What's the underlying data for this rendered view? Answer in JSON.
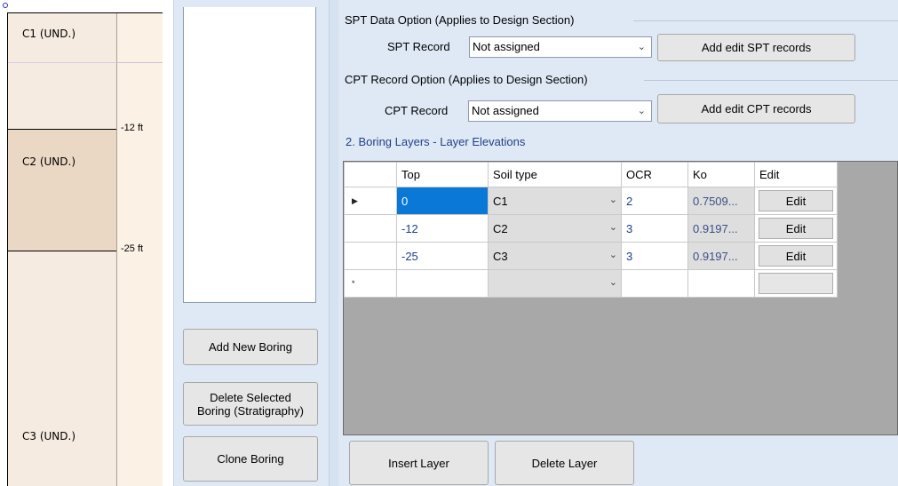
{
  "stratigraphy": {
    "layers": [
      {
        "label": "C1 (UND.)",
        "color": "#f5ebe0"
      },
      {
        "label": "C2 (UND.)",
        "color": "#ead8c4"
      },
      {
        "label": "C3 (UND.)",
        "color": "#f5ebe0"
      }
    ],
    "elevations": [
      "-12 ft",
      "-25 ft"
    ]
  },
  "boring_panel": {
    "add_new_boring": "Add New Boring",
    "delete_selected_boring_line1": "Delete Selected",
    "delete_selected_boring_line2": "Boring (Stratigraphy)",
    "clone_boring": "Clone Boring"
  },
  "spt": {
    "group_title": "SPT Data Option (Applies to Design Section)",
    "label": "SPT Record",
    "value": "Not assigned",
    "button": "Add edit SPT records"
  },
  "cpt": {
    "group_title": "CPT Record Option (Applies to Design Section)",
    "label": "CPT Record",
    "value": "Not assigned",
    "button": "Add edit CPT records"
  },
  "layers_section": {
    "title": "2. Boring Layers - Layer Elevations",
    "columns": [
      "Top",
      "Soil type",
      "OCR",
      "Ko",
      "Edit"
    ],
    "rows": [
      {
        "indicator": "▶",
        "top": "0",
        "soil": "C1",
        "ocr": "2",
        "ko": "0.7509...",
        "edit": "Edit"
      },
      {
        "indicator": "",
        "top": "-12",
        "soil": "C2",
        "ocr": "3",
        "ko": "0.9197...",
        "edit": "Edit"
      },
      {
        "indicator": "",
        "top": "-25",
        "soil": "C3",
        "ocr": "3",
        "ko": "0.9197...",
        "edit": "Edit"
      },
      {
        "indicator": "*",
        "top": "",
        "soil": "",
        "ocr": "",
        "ko": "",
        "edit": ""
      }
    ],
    "insert_layer": "Insert Layer",
    "delete_layer": "Delete Layer"
  },
  "icons": {
    "dropdown": "chevron-down-icon",
    "current_row": "row-pointer-icon",
    "new_row": "new-row-icon"
  }
}
